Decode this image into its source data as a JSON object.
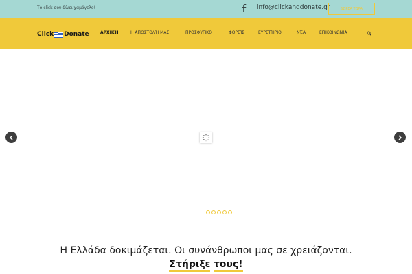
{
  "topbar": {
    "tagline": "Το click σου δίνει χαμόγελο!",
    "email": "info@clickanddonate.gr",
    "donate_button": "ΔΩΡΕΑ ΤΩΡΑ"
  },
  "logo": {
    "part1": "Click",
    "part2": "Donate"
  },
  "nav": {
    "items": [
      "ΑΡΧΙΚΉ",
      "Η ΑΠΟΣΤΟΛΉ ΜΑΣ",
      "ΠΡΟΣΦΥΓΙΚΌ",
      "ΦΟΡΕΊΣ",
      "ΕΥΡΕΤΉΡΙΟ",
      "ΝΈΑ",
      "ΕΠΙΚΟΙΝΩΝΊΑ"
    ],
    "active": 0
  },
  "headline": {
    "text": "Η Ελλάδα δοκιμάζεται. Οι συνάνθρωποι μας σε χρειάζονται.",
    "strong1": "Στήριξε",
    "strong2": "τους!"
  },
  "colors": {
    "accent": "#f0c93a",
    "topbar": "#a5d8d3",
    "arrow": "#3e3e3e"
  },
  "icons": [
    "facebook-icon",
    "search-icon",
    "chevron-left-icon",
    "chevron-right-icon",
    "loading-spinner-icon",
    "greek-flag-icon"
  ]
}
